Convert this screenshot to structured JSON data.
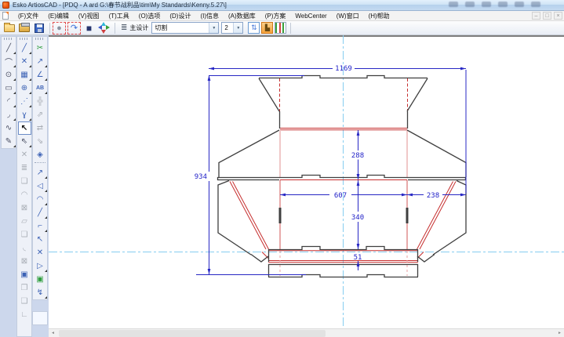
{
  "window": {
    "title": "Esko ArtiosCAD - [PDQ - A ard G:\\春节战利品\\tim\\My Standards\\Kenny.5.27\\]"
  },
  "menu": {
    "items": [
      {
        "label": "(F)文件"
      },
      {
        "label": "(E)编辑"
      },
      {
        "label": "(V)视图"
      },
      {
        "label": "(T)工具"
      },
      {
        "label": "(O)选项"
      },
      {
        "label": "(D)设计"
      },
      {
        "label": "(I)信息"
      },
      {
        "label": "(A)数据库"
      },
      {
        "label": "(P)方案"
      },
      {
        "label": "WebCenter"
      },
      {
        "label": "(W)窗口"
      },
      {
        "label": "(H)帮助"
      }
    ]
  },
  "toolbar": {
    "main_design": {
      "label": "主设计"
    },
    "line_type": {
      "value": "切割"
    },
    "point_size": {
      "value": "2"
    }
  },
  "icons": {
    "open": "open-folder-css-shape",
    "output": "output-device-css-shape",
    "save": "floppy-css-shape",
    "playback": "●",
    "redo_arrow": "↷",
    "box3d": "■",
    "sheets": "≣",
    "layer_toggle": "⇅",
    "counter": "▙",
    "combo_arrow": "▼",
    "scroll_left": "◄",
    "scroll_right": "►",
    "mdi_min": "–",
    "mdi_restore": "□",
    "mdi_close": "×"
  },
  "dock": {
    "col1": [
      {
        "name": "line",
        "g": "╱"
      },
      {
        "name": "arc",
        "g": "⌒"
      },
      {
        "name": "circle",
        "g": "⊙"
      },
      {
        "name": "rectangle",
        "g": "▭"
      },
      {
        "name": "fillet",
        "g": "◜"
      },
      {
        "name": "curve",
        "g": "◞"
      },
      {
        "name": "wave",
        "g": "∿"
      },
      {
        "name": "bezier",
        "g": "✎"
      }
    ],
    "col2": [
      {
        "name": "line2",
        "g": "╱"
      },
      {
        "name": "construct",
        "g": "✕"
      },
      {
        "name": "hatch",
        "g": "▦"
      },
      {
        "name": "circle-center",
        "g": "⊕"
      },
      {
        "name": "ray-fan",
        "g": "⋰"
      },
      {
        "name": "conic",
        "g": "ɣ"
      },
      {
        "name": "select",
        "g": "↖"
      },
      {
        "name": "group-select",
        "g": "⇖"
      },
      {
        "name": "delete",
        "g": "✕"
      },
      {
        "name": "layers",
        "g": "≣"
      },
      {
        "name": "copy",
        "g": "❏"
      },
      {
        "name": "arc-edit",
        "g": "◠"
      },
      {
        "name": "frame",
        "g": "⊠"
      },
      {
        "name": "region",
        "g": "▱"
      },
      {
        "name": "paste",
        "g": "❏"
      },
      {
        "name": "fillet-edit",
        "g": "◟"
      },
      {
        "name": "crop",
        "g": "⊠"
      },
      {
        "name": "convert-3d",
        "g": "▣"
      },
      {
        "name": "boxes-3d",
        "g": "❐"
      },
      {
        "name": "outline-boxes",
        "g": "❑"
      },
      {
        "name": "corner",
        "g": "∟"
      }
    ],
    "col3a": [
      {
        "name": "tack",
        "g": "✂"
      },
      {
        "name": "dimension",
        "g": "↗"
      },
      {
        "name": "angle-dim",
        "g": "∠"
      },
      {
        "name": "text",
        "g": "AB"
      },
      {
        "name": "move",
        "g": "╬"
      },
      {
        "name": "rotate",
        "g": "⇗"
      },
      {
        "name": "mirror",
        "g": "⇄"
      },
      {
        "name": "scale",
        "g": "⇘"
      },
      {
        "name": "transform",
        "g": "◈"
      }
    ],
    "col3b": [
      {
        "name": "measure",
        "g": "↗"
      },
      {
        "name": "angle",
        "g": "◁"
      },
      {
        "name": "arc-dim",
        "g": "◠"
      },
      {
        "name": "line-dim",
        "g": "╱"
      },
      {
        "name": "corner-dim",
        "g": "⌐"
      },
      {
        "name": "annotate",
        "g": "↖"
      },
      {
        "name": "cross",
        "g": "✕"
      },
      {
        "name": "arrow",
        "g": "▷"
      },
      {
        "name": "counter",
        "g": "▣"
      },
      {
        "name": "zigzag",
        "g": "↯"
      }
    ]
  },
  "drawing": {
    "dims": {
      "top_width": "1169",
      "left_height": "934",
      "upper_panel": "288",
      "panel_width": "607",
      "side_panel": "238",
      "mid_height": "340",
      "bottom_strip": "51"
    },
    "colors": {
      "cut": "#3f3f3f",
      "crease": "#c62f2f",
      "crease_light": "#e29090",
      "dimension": "#2727c4",
      "centerline": "#86cdf0"
    }
  }
}
